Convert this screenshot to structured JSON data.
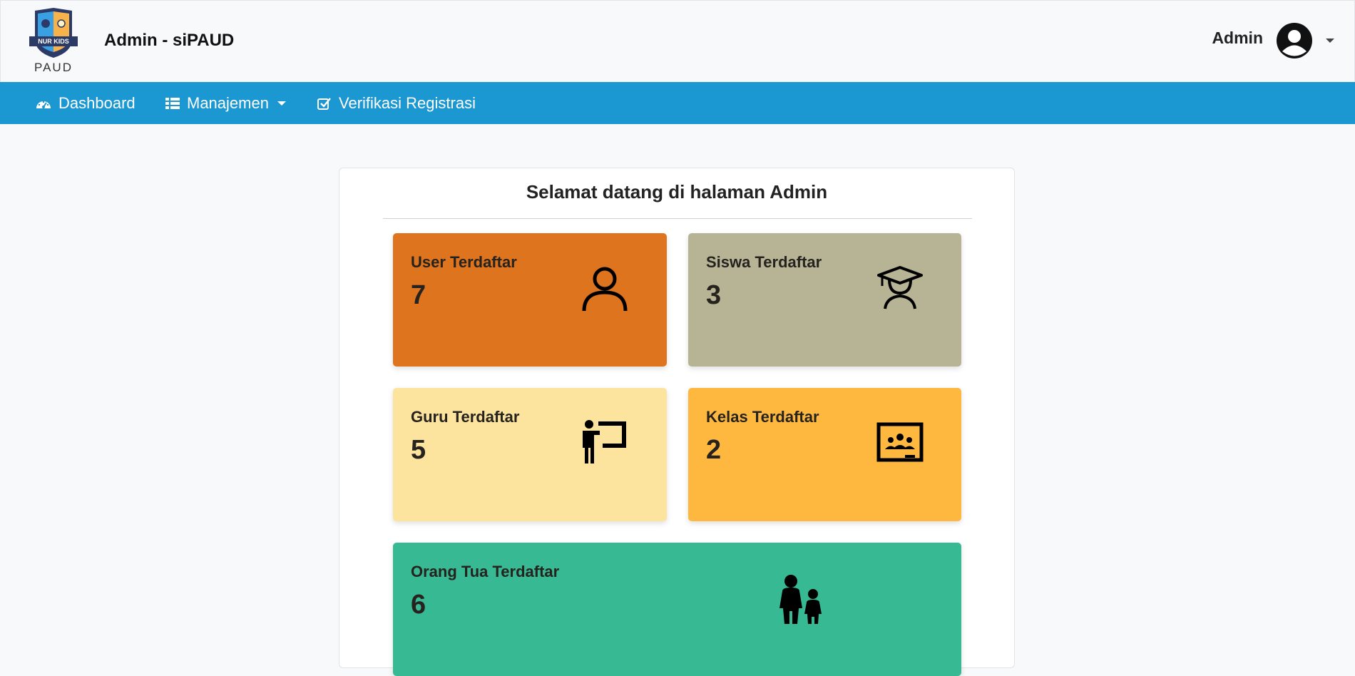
{
  "header": {
    "logo_badge": "NUR KIDS",
    "logo_text": "PAUD",
    "app_title": "Admin - siPAUD",
    "user_name": "Admin"
  },
  "nav": {
    "items": [
      {
        "label": "Dashboard",
        "icon": "dashboard-icon"
      },
      {
        "label": "Manajemen",
        "icon": "table-list-icon",
        "has_dropdown": true
      },
      {
        "label": "Verifikasi Registrasi",
        "icon": "check-square-icon"
      }
    ]
  },
  "main": {
    "title": "Selamat datang di halaman Admin",
    "cards": [
      {
        "label": "User Terdaftar",
        "value": "7",
        "color": "#df741e",
        "icon": "user-icon"
      },
      {
        "label": "Siswa Terdaftar",
        "value": "3",
        "color": "#b6b495",
        "icon": "student-icon"
      },
      {
        "label": "Guru Terdaftar",
        "value": "5",
        "color": "#fce49e",
        "icon": "teacher-icon"
      },
      {
        "label": "Kelas Terdaftar",
        "value": "2",
        "color": "#feb83f",
        "icon": "classroom-icon"
      },
      {
        "label": "Orang Tua Terdaftar",
        "value": "6",
        "color": "#37b994",
        "icon": "parent-child-icon"
      }
    ]
  },
  "colors": {
    "navbar": "#1b97d1",
    "background": "#f8f9fa"
  }
}
